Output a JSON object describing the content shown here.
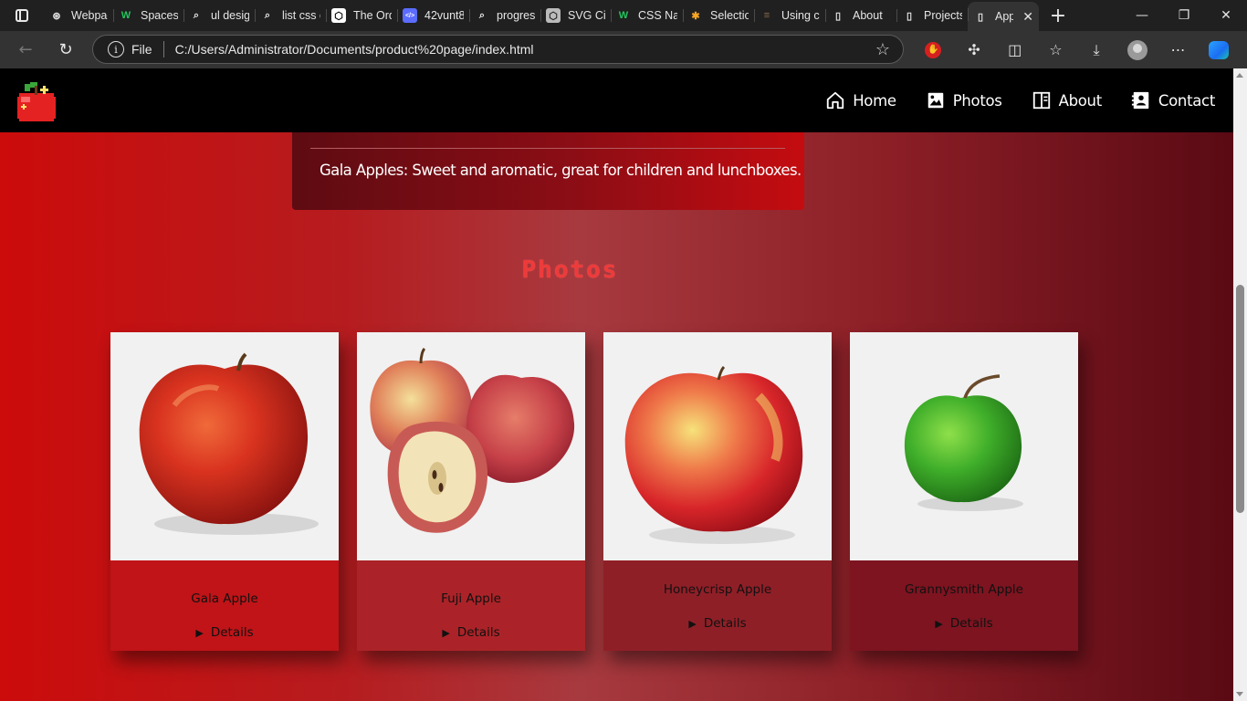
{
  "browser": {
    "tabs": [
      {
        "label": "Webpag",
        "favicon": "chatgpt-icon",
        "fav_text": "⊛",
        "fav_color": "#e6e6e6"
      },
      {
        "label": "Spaces",
        "favicon": "w-logo-icon",
        "fav_text": "W",
        "fav_color": "#22c55e"
      },
      {
        "label": "ul desig",
        "favicon": "search-icon",
        "fav_text": "⌕",
        "fav_color": "#e6e6e6"
      },
      {
        "label": "list css c",
        "favicon": "search-icon",
        "fav_text": "⌕",
        "fav_color": "#e6e6e6"
      },
      {
        "label": "The Ord",
        "favicon": "codepen-icon",
        "fav_text": "⬡",
        "fav_color": "#ffffff"
      },
      {
        "label": "42vunt8",
        "favicon": "code-icon",
        "fav_text": "</>",
        "fav_color": "#5b6cff"
      },
      {
        "label": "progres",
        "favicon": "search-icon",
        "fav_text": "⌕",
        "fav_color": "#e6e6e6"
      },
      {
        "label": "SVG Cir",
        "favicon": "codepen-icon",
        "fav_text": "⬡",
        "fav_color": "#bbbbbb"
      },
      {
        "label": "CSS Nav",
        "favicon": "w-logo-icon",
        "fav_text": "W",
        "fav_color": "#22c55e"
      },
      {
        "label": "Selectio",
        "favicon": "colorful-icon",
        "fav_text": "✱",
        "fav_color": "#f5a623"
      },
      {
        "label": "Using c",
        "favicon": "stackoverflow-icon",
        "fav_text": "≡",
        "fav_color": "#8a6a4a"
      },
      {
        "label": "About",
        "favicon": "page-icon",
        "fav_text": "▯",
        "fav_color": "#e6e6e6"
      },
      {
        "label": "Projects",
        "favicon": "page-icon",
        "fav_text": "▯",
        "fav_color": "#e6e6e6"
      },
      {
        "label": "App",
        "favicon": "page-icon",
        "fav_text": "▯",
        "fav_color": "#e6e6e6",
        "active": true
      }
    ],
    "address": {
      "scheme_label": "File",
      "url": "C:/Users/Administrator/Documents/product%20page/index.html"
    }
  },
  "site": {
    "nav": {
      "items": [
        {
          "label": "Home",
          "icon": "home-icon"
        },
        {
          "label": "Photos",
          "icon": "image-icon"
        },
        {
          "label": "About",
          "icon": "book-icon"
        },
        {
          "label": "Contact",
          "icon": "contact-card-icon"
        }
      ]
    },
    "info_box": {
      "text": "Gala Apples: Sweet and aromatic, great for children and lunchboxes."
    },
    "photos": {
      "title": "Photos",
      "cards": [
        {
          "name": "Gala Apple",
          "details": "Details"
        },
        {
          "name": "Fuji Apple",
          "details": "Details"
        },
        {
          "name": "Honeycrisp Apple",
          "details": "Details"
        },
        {
          "name": "Grannysmith Apple",
          "details": "Details"
        }
      ]
    }
  },
  "colors": {
    "nav_bg": "#000000",
    "section_title": "#ef3a3a",
    "page_gradient_start": "#cc0b0b",
    "page_gradient_end": "#5a0a14"
  }
}
